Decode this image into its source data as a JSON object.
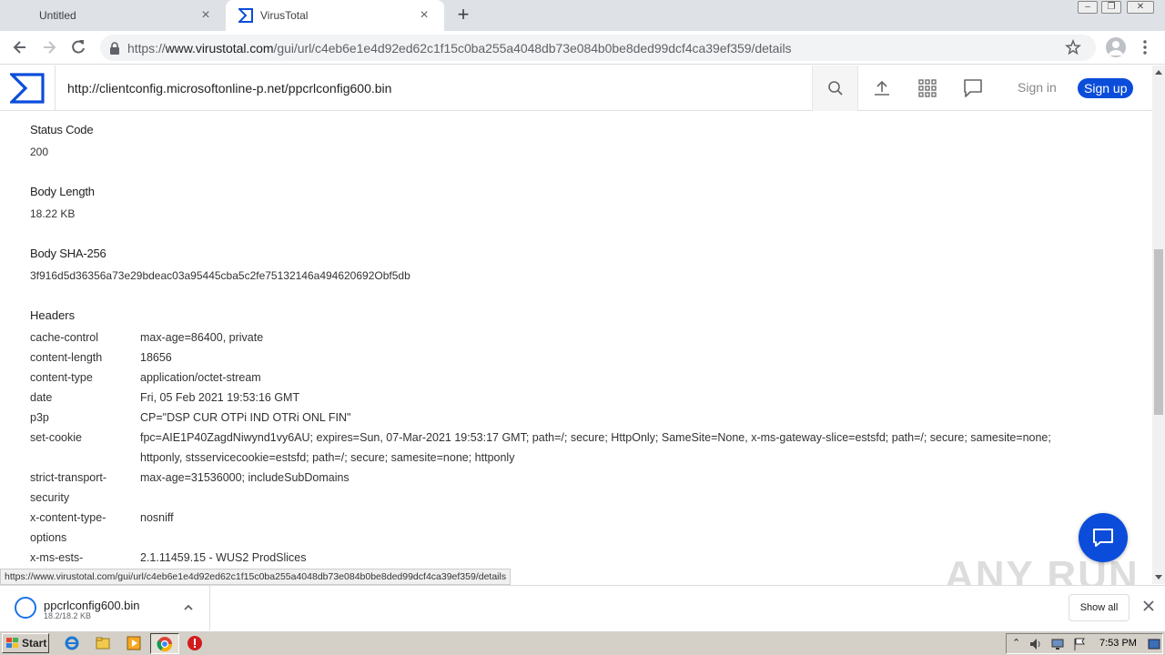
{
  "browser": {
    "tabs": [
      {
        "title": "Untitled",
        "active": false
      },
      {
        "title": "VirusTotal",
        "active": true
      }
    ],
    "address": {
      "scheme": "https://",
      "host": "www.virustotal.com",
      "path": "/gui/url/c4eb6e1e4d92ed62c1f15c0ba255a4048db73e084b0be8ded99dcf4ca39ef359/details"
    },
    "status_url": "https://www.virustotal.com/gui/url/c4eb6e1e4d92ed62c1f15c0ba255a4048db73e084b0be8ded99dcf4ca39ef359/details"
  },
  "vt_header": {
    "search_value": "http://clientconfig.microsoftonline-p.net/ppcrlconfig600.bin",
    "signin_label": "Sign in",
    "signup_label": "Sign up",
    "accent": "#0b4dda"
  },
  "details": {
    "status_code": {
      "label": "Status Code",
      "value": "200"
    },
    "body_length": {
      "label": "Body Length",
      "value": "18.22 KB"
    },
    "body_sha256": {
      "label": "Body SHA-256",
      "value": "3f916d5d36356a73e29bdeac03a95445cba5c2fe75132146a494620692Obf5db"
    },
    "headers_title": "Headers",
    "headers": [
      {
        "k": "cache-control",
        "v": "max-age=86400, private"
      },
      {
        "k": "content-length",
        "v": "18656"
      },
      {
        "k": "content-type",
        "v": "application/octet-stream"
      },
      {
        "k": "date",
        "v": "Fri, 05 Feb 2021 19:53:16 GMT"
      },
      {
        "k": "p3p",
        "v": "CP=\"DSP CUR OTPi IND OTRi ONL FIN\""
      },
      {
        "k": "set-cookie",
        "v": "fpc=AIE1P40ZagdNiwynd1vy6AU; expires=Sun, 07-Mar-2021 19:53:17 GMT; path=/; secure; HttpOnly; SameSite=None, x-ms-gateway-slice=estsfd; path=/; secure; samesite=none; httponly, stsservicecookie=estsfd; path=/; secure; samesite=none; httponly"
      },
      {
        "k": "strict-transport-security",
        "v": "max-age=31536000; includeSubDomains"
      },
      {
        "k": "x-content-type-options",
        "v": "nosniff"
      },
      {
        "k": "x-ms-ests-",
        "v": "2.1.11459.15 - WUS2 ProdSlices"
      }
    ]
  },
  "watermark": "ANY RUN",
  "download": {
    "filename": "ppcrlconfig600.bin",
    "size": "18.2/18.2 KB",
    "show_all": "Show all"
  },
  "taskbar": {
    "start_label": "Start",
    "clock": "7:53 PM"
  }
}
